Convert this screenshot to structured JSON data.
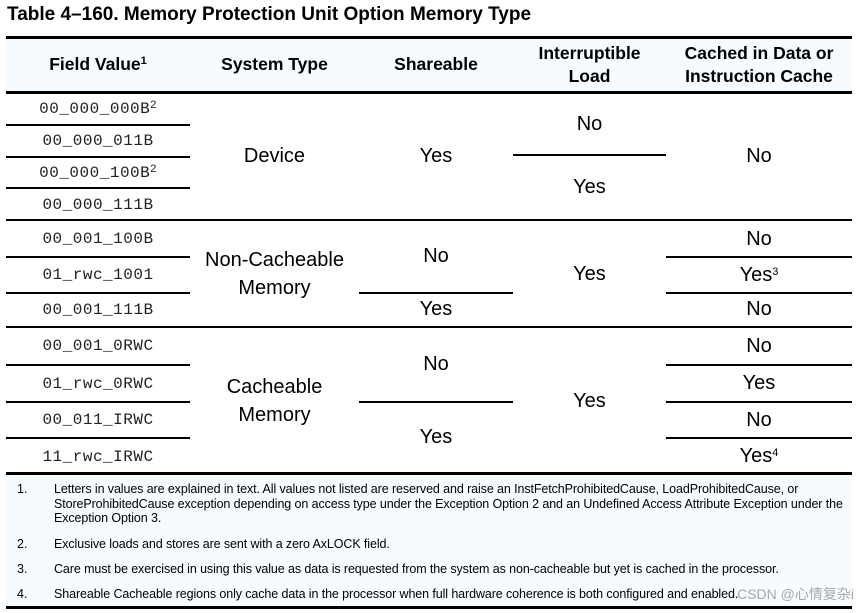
{
  "title": "Table 4–160.  Memory Protection Unit Option Memory Type",
  "headers": {
    "field_value": "Field Value",
    "field_value_note": "1",
    "system_type": "System Type",
    "shareable": "Shareable",
    "interruptible_line1": "Interruptible",
    "interruptible_line2": "Load",
    "cached_line1": "Cached in Data or",
    "cached_line2": "Instruction Cache"
  },
  "rows": [
    {
      "field": "00_000_000B",
      "note": "2"
    },
    {
      "field": "00_000_011B",
      "note": ""
    },
    {
      "field": "00_000_100B",
      "note": "2"
    },
    {
      "field": "00_000_111B",
      "note": ""
    },
    {
      "field": "00_001_100B",
      "note": ""
    },
    {
      "field": "01_rwc_1001",
      "note": ""
    },
    {
      "field": "00_001_111B",
      "note": ""
    },
    {
      "field": "00_001_0RWC",
      "note": ""
    },
    {
      "field": "01_rwc_0RWC",
      "note": ""
    },
    {
      "field": "00_011_IRWC",
      "note": ""
    },
    {
      "field": "11_rwc_IRWC",
      "note": ""
    }
  ],
  "groups": {
    "device": {
      "system_type": "Device",
      "shareable": "Yes",
      "interruptible": [
        "No",
        "Yes"
      ],
      "cached": "No"
    },
    "noncacheable": {
      "system_type_line1": "Non-Cacheable",
      "system_type_line2": "Memory",
      "shareable": [
        "No",
        "Yes"
      ],
      "interruptible": "Yes",
      "cached": [
        {
          "value": "No",
          "note": ""
        },
        {
          "value": "Yes",
          "note": "3"
        },
        {
          "value": "No",
          "note": ""
        }
      ]
    },
    "cacheable": {
      "system_type_line1": "Cacheable",
      "system_type_line2": "Memory",
      "shareable": [
        "No",
        "Yes"
      ],
      "interruptible": "Yes",
      "cached": [
        {
          "value": "No",
          "note": ""
        },
        {
          "value": "Yes",
          "note": ""
        },
        {
          "value": "No",
          "note": ""
        },
        {
          "value": "Yes",
          "note": "4"
        }
      ]
    }
  },
  "footnotes": [
    {
      "num": "1.",
      "text": "Letters in values are explained in text. All values not listed are reserved and raise an InstFetchProhibitedCause, LoadProhibitedCause, or StoreProhibitedCause exception depending on access type under the Exception Option 2 and an Undefined Access Attribute Exception under the Exception Option 3."
    },
    {
      "num": "2.",
      "text": "Exclusive loads and stores are sent with a zero AxLOCK field."
    },
    {
      "num": "3.",
      "text": "Care must be exercised in using this value as data is requested from the system as non-cacheable but yet is cached in the processor."
    },
    {
      "num": "4.",
      "text": "Shareable Cacheable regions only cache data in the processor when full hardware coherence is both configured and enabled."
    }
  ],
  "watermark": "CSDN @心情复杂i",
  "colors": {
    "band": "#f6fbff",
    "rule": "#000000"
  }
}
